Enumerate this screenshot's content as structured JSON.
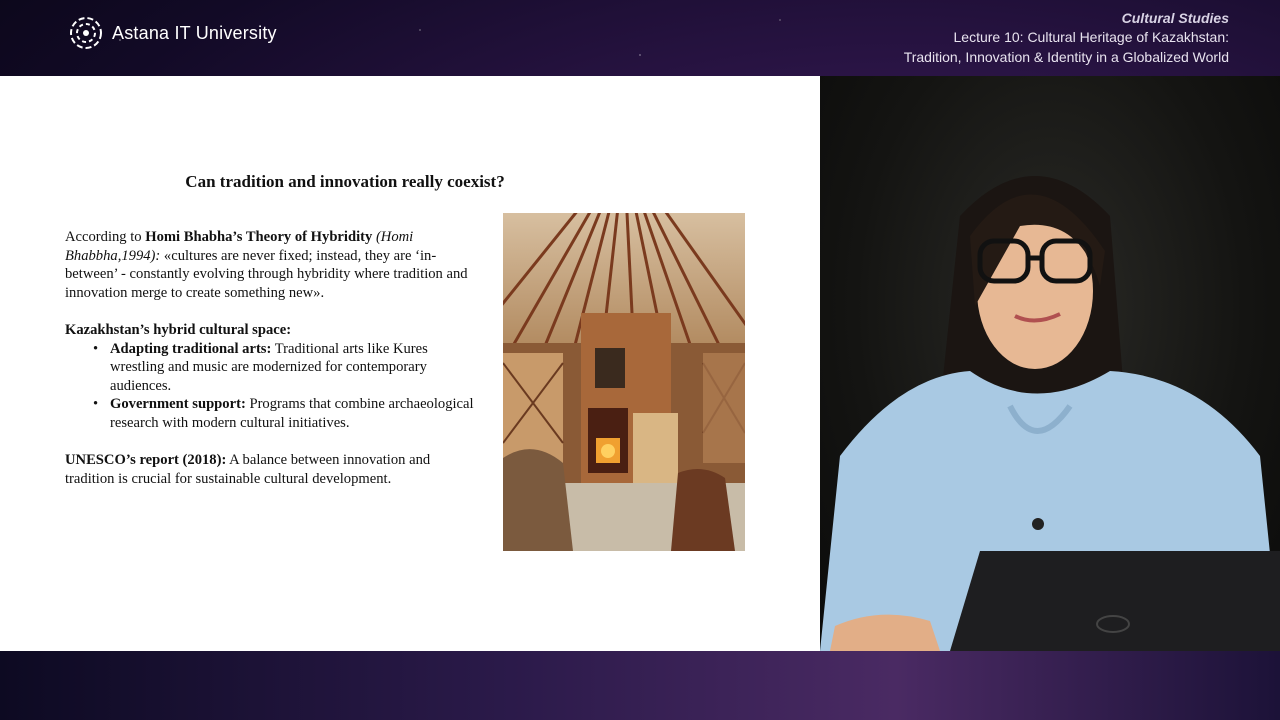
{
  "header": {
    "logo_text": "Astana IT University",
    "course": "Cultural Studies",
    "lecture_line1": "Lecture 10: Cultural Heritage of Kazakhstan:",
    "lecture_line2": "Tradition, Innovation & Identity in a Globalized World"
  },
  "slide": {
    "title": "Can tradition and innovation really coexist?",
    "intro": {
      "prefix": "According to ",
      "bold": "Homi Bhabha’s Theory of Hybridity",
      "italic": " (Homi Bhabbha,1994):",
      "text": " «cultures are never fixed; instead, they are ‘in-between’ - constantly evolving through hybridity where tradition and innovation merge to create something new»."
    },
    "section_heading": "Kazakhstan’s hybrid cultural space:",
    "bullets": [
      {
        "bold": "Adapting traditional arts:",
        "text": " Traditional arts like Kures wrestling and music are modernized for contemporary audiences."
      },
      {
        "bold": "Government support:",
        "text": " Programs that combine archaeological research with modern cultural initiatives."
      }
    ],
    "unesco": {
      "bold": "UNESCO’s report (2018):",
      "text": " A balance between innovation and tradition is crucial for sustainable cultural development."
    },
    "image": {
      "subject": "yurt interior photograph"
    }
  },
  "video": {
    "subject": "lecturer webcam feed"
  },
  "colors": {
    "slide_bg": "#ffffff",
    "header_text": "#e6e0ee",
    "background": "#1a0f33"
  }
}
